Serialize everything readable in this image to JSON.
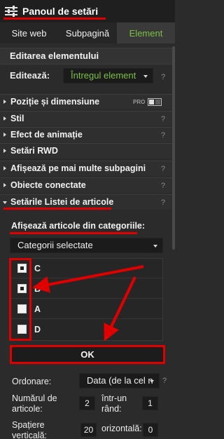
{
  "header": {
    "title": "Panoul de setări",
    "menu_icon": "menu-sliders-icon"
  },
  "tabs": [
    {
      "label": "Site web",
      "active": false
    },
    {
      "label": "Subpagină",
      "active": false
    },
    {
      "label": "Element",
      "active": true
    }
  ],
  "section": {
    "title": "Editarea elementului"
  },
  "edit": {
    "label": "Editează:",
    "value": "Întregul element",
    "help": "?"
  },
  "accordions": [
    {
      "label": "Poziție și dimensiune",
      "badge": "PRO",
      "help": "",
      "expanded": false
    },
    {
      "label": "Stil",
      "help": "?",
      "expanded": false
    },
    {
      "label": "Efect de animație",
      "help": "?",
      "expanded": false
    },
    {
      "label": "Setări RWD",
      "help": "",
      "expanded": false
    },
    {
      "label": "Afișează pe mai multe subpagini",
      "help": "?",
      "expanded": false
    },
    {
      "label": "Obiecte conectate",
      "help": "?",
      "expanded": false
    },
    {
      "label": "Setările Listei de articole",
      "help": "?",
      "expanded": true
    }
  ],
  "article_list": {
    "categories_label": "Afișează articole din categoriile:",
    "categories_select": "Categorii selectate",
    "categories": [
      {
        "label": "C",
        "checked": true
      },
      {
        "label": "B",
        "checked": true
      },
      {
        "label": "A",
        "checked": false
      },
      {
        "label": "D",
        "checked": false
      }
    ],
    "ok_label": "OK",
    "order_label": "Ordonare:",
    "order_value": "Data (de la cel n",
    "order_help": "?",
    "count_label_1": "Numărul de",
    "count_label_2": "articole:",
    "count_value": "2",
    "per_row_label_1": "într-un",
    "per_row_label_2": "rând:",
    "per_row_value": "1",
    "spacing_label_1": "Spațiere",
    "spacing_label_2": "verticală:",
    "spacing_vertical_value": "20",
    "spacing_h_label": "orizontală:",
    "spacing_horizontal_value": "0"
  },
  "colors": {
    "accent_green": "#7bc142",
    "annotation_red": "#e00000",
    "background": "#2b2b2b"
  }
}
